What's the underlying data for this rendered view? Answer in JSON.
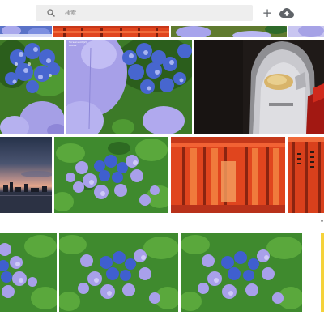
{
  "search": {
    "placeholder": "検索"
  },
  "icons": {
    "search": "search-icon",
    "add": "plus-icon",
    "upload": "cloud-upload-icon"
  },
  "photos": [
    {
      "subject": "hydrangea",
      "caption": [
        "Screenshot (2)",
        "LA001"
      ]
    }
  ],
  "colors": {
    "search_bg": "#eeeeee",
    "icon": "#5f6368",
    "torii_red": "#e0451e",
    "hydrangea_blue": "#4a6cd4",
    "hydrangea_lavender": "#a8a0e8",
    "leaf_green": "#3e8a2e",
    "accent_yellow": "#f5d23a"
  }
}
